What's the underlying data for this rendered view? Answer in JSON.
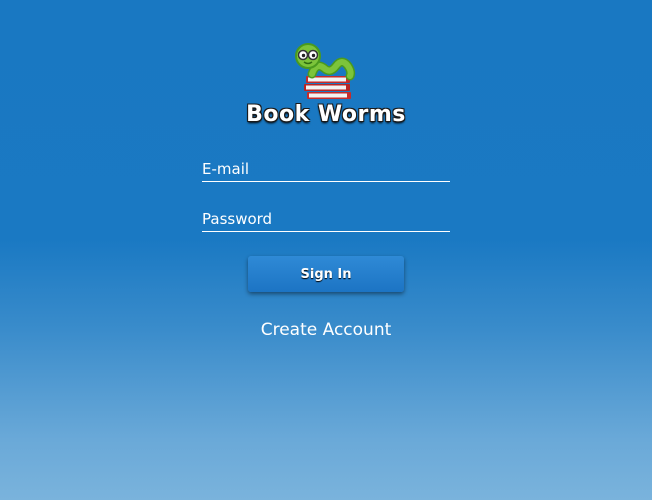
{
  "app": {
    "title": "Book Worms",
    "logo_icon": "bookworm-on-books-icon"
  },
  "login": {
    "email_placeholder": "E-mail",
    "password_placeholder": "Password",
    "signin_label": "Sign In",
    "create_account_label": "Create Account"
  },
  "colors": {
    "background_top": "#1978c2",
    "background_bottom": "#7ab3dc",
    "button": "#2280cc",
    "text": "#ffffff"
  }
}
